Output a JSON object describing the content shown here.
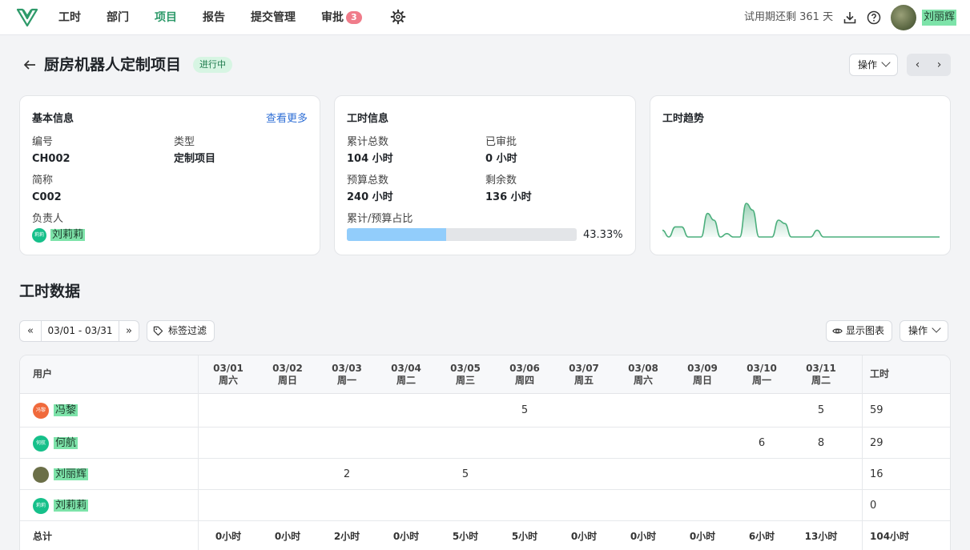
{
  "nav": {
    "items": [
      {
        "label": "工时"
      },
      {
        "label": "部门"
      },
      {
        "label": "项目"
      },
      {
        "label": "报告"
      },
      {
        "label": "提交管理"
      },
      {
        "label": "审批",
        "badge": "3"
      }
    ],
    "active": "项目",
    "trial_text": "试用期还剩 361 天",
    "user_name": "刘丽辉"
  },
  "project": {
    "title": "厨房机器人定制项目",
    "status": "进行中",
    "actions_label": "操作",
    "prev_icon": "‹",
    "next_icon": "›"
  },
  "basic_info": {
    "title": "基本信息",
    "more_label": "查看更多",
    "code_label": "编号",
    "code_value": "CH002",
    "type_label": "类型",
    "type_value": "定制项目",
    "short_label": "简称",
    "short_value": "C002",
    "owner_label": "负责人",
    "owner_avatar": "莉莉",
    "owner_name": "刘莉莉"
  },
  "hours_info": {
    "title": "工时信息",
    "total_label": "累计总数",
    "total_value": "104 小时",
    "approved_label": "已审批",
    "approved_value": "0 小时",
    "budget_label": "预算总数",
    "budget_value": "240 小时",
    "remaining_label": "剩余数",
    "remaining_value": "136 小时",
    "ratio_label": "累计/预算占比",
    "ratio_value": "43.33%",
    "ratio_fraction": 0.4333
  },
  "trend": {
    "title": "工时趋势",
    "chart_data": {
      "type": "area",
      "values": [
        2,
        0,
        3,
        3,
        0,
        0,
        0,
        7,
        5,
        0,
        1,
        0,
        0,
        10,
        8,
        0,
        0,
        0,
        5,
        4,
        0,
        0,
        0,
        0,
        2,
        0,
        0,
        0,
        0,
        0,
        0,
        0,
        0,
        0,
        0,
        0,
        0,
        0,
        0,
        0,
        0,
        0,
        0,
        0
      ],
      "color": "#4caf7d"
    }
  },
  "timesheet": {
    "title": "工时数据",
    "range_label": "03/01 - 03/31",
    "prev_label": "«",
    "next_label": "»",
    "tag_filter_label": "标签过滤",
    "show_chart_label": "显示图表",
    "actions_label": "操作",
    "user_header": "用户",
    "total_header": "工时",
    "columns": [
      {
        "date": "03/01",
        "weekday": "周六"
      },
      {
        "date": "03/02",
        "weekday": "周日"
      },
      {
        "date": "03/03",
        "weekday": "周一"
      },
      {
        "date": "03/04",
        "weekday": "周二"
      },
      {
        "date": "03/05",
        "weekday": "周三"
      },
      {
        "date": "03/06",
        "weekday": "周四"
      },
      {
        "date": "03/07",
        "weekday": "周五"
      },
      {
        "date": "03/08",
        "weekday": "周六"
      },
      {
        "date": "03/09",
        "weekday": "周日"
      },
      {
        "date": "03/10",
        "weekday": "周一"
      },
      {
        "date": "03/11",
        "weekday": "周二"
      }
    ],
    "rows": [
      {
        "name": "冯黎",
        "avatar": "冯黎",
        "avatar_color": "#f06a3c",
        "cells": [
          "",
          "",
          "",
          "",
          "",
          "5",
          "",
          "",
          "",
          "",
          "5"
        ],
        "total": "59"
      },
      {
        "name": "何航",
        "avatar": "何航",
        "avatar_color": "#16c08a",
        "cells": [
          "",
          "",
          "",
          "",
          "",
          "",
          "",
          "",
          "",
          "6",
          "8"
        ],
        "total": "29"
      },
      {
        "name": "刘丽辉",
        "avatar": "",
        "avatar_color": "#6b6f48",
        "cells": [
          "",
          "",
          "2",
          "",
          "5",
          "",
          "",
          "",
          "",
          "",
          ""
        ],
        "total": "16"
      },
      {
        "name": "刘莉莉",
        "avatar": "莉莉",
        "avatar_color": "#16c08a",
        "cells": [
          "",
          "",
          "",
          "",
          "",
          "",
          "",
          "",
          "",
          "",
          ""
        ],
        "total": "0"
      }
    ],
    "footer_label": "总计",
    "footer_cells": [
      "0小时",
      "0小时",
      "2小时",
      "0小时",
      "5小时",
      "5小时",
      "0小时",
      "0小时",
      "0小时",
      "6小时",
      "13小时"
    ],
    "footer_total": "104小时"
  }
}
